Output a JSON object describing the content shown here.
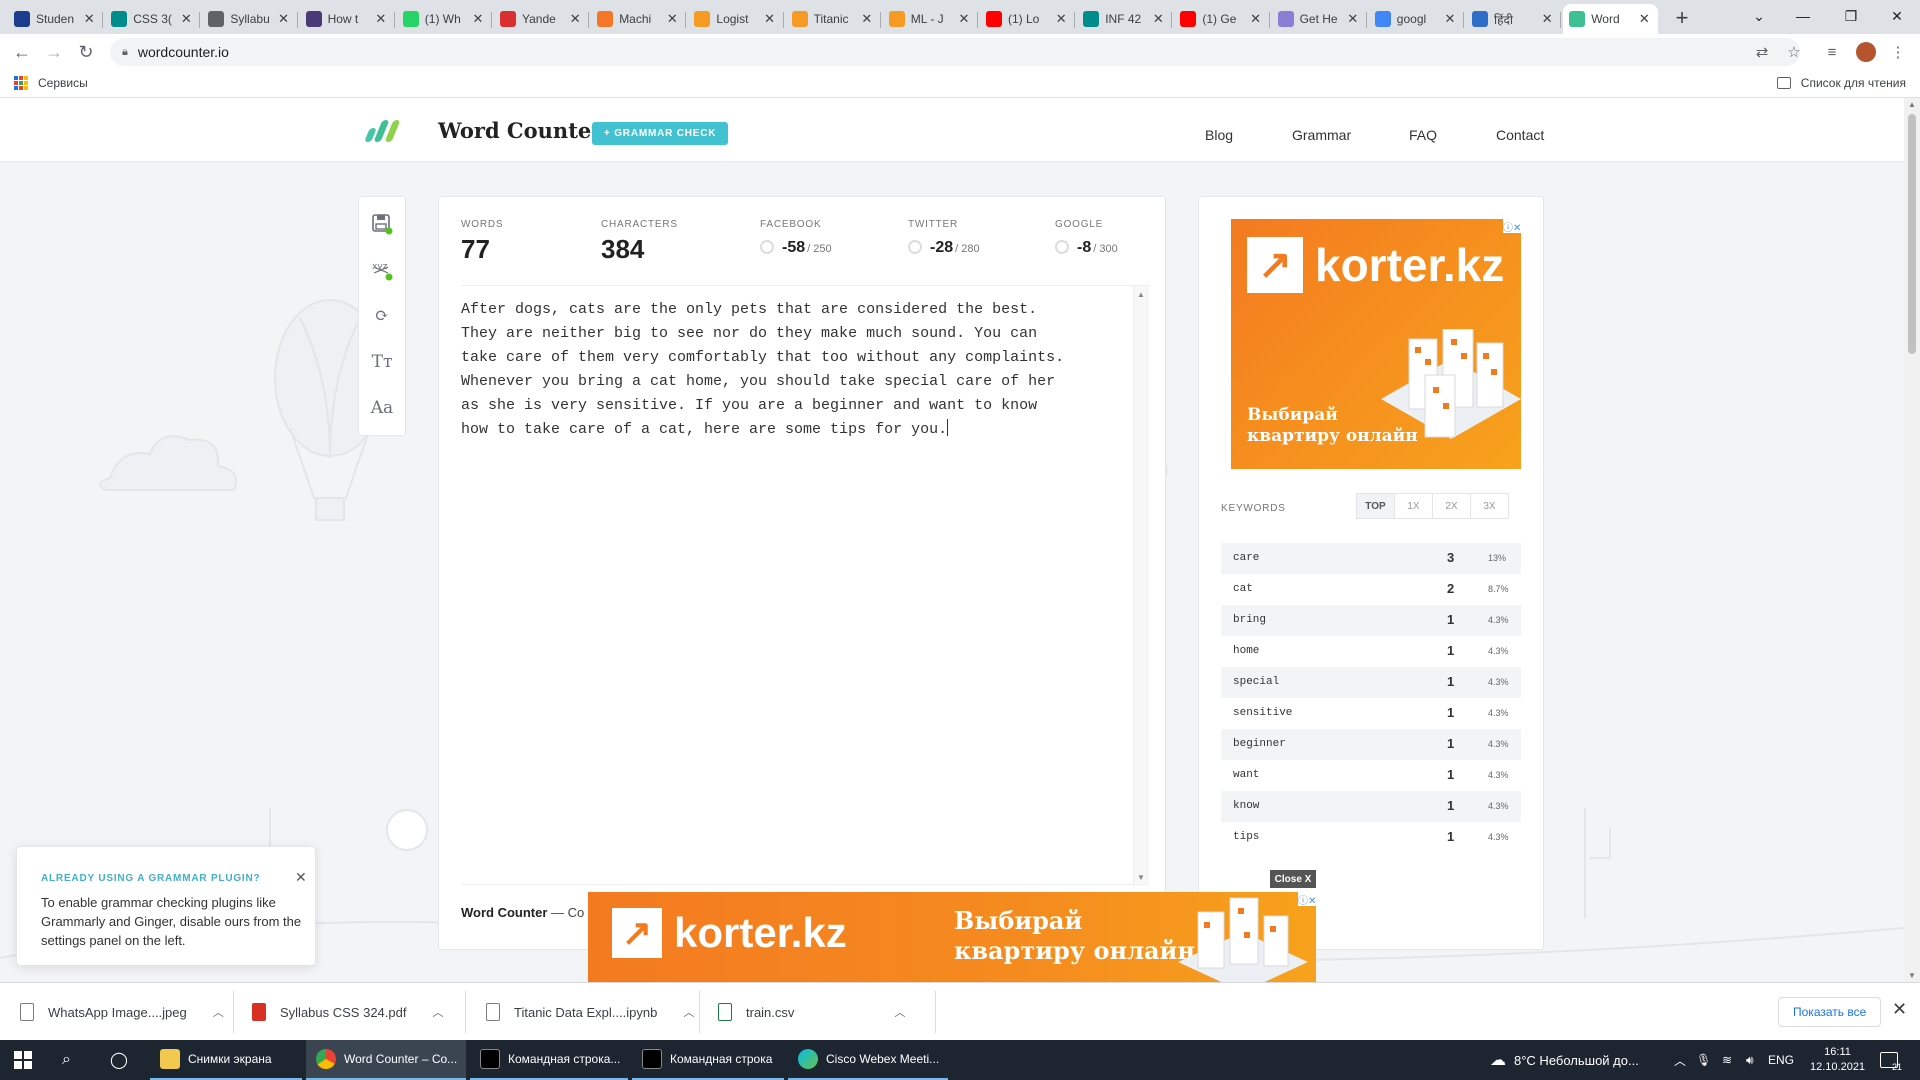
{
  "browser": {
    "tabs": [
      {
        "title": "Studen",
        "icon": "stackoverflow-icon",
        "color": "#1d3c8e"
      },
      {
        "title": "CSS 3(",
        "icon": "colab-icon",
        "color": "#008c8c"
      },
      {
        "title": "Syllabu",
        "icon": "globe-icon",
        "color": "#5f6368"
      },
      {
        "title": "How t",
        "icon": "medium-icon",
        "color": "#4b3a78"
      },
      {
        "title": "(1) Wh",
        "icon": "whatsapp-icon",
        "color": "#25d366"
      },
      {
        "title": "Yande",
        "icon": "yandex-icon",
        "color": "#d92f2f"
      },
      {
        "title": "Machi",
        "icon": "jupyter-icon",
        "color": "#f37726"
      },
      {
        "title": "Logist",
        "icon": "book-icon",
        "color": "#f59b23"
      },
      {
        "title": "Titanic",
        "icon": "book-icon",
        "color": "#f59b23"
      },
      {
        "title": "ML - J",
        "icon": "book-icon",
        "color": "#f59b23"
      },
      {
        "title": "(1) Lo",
        "icon": "youtube-icon",
        "color": "#ff0000"
      },
      {
        "title": "INF 42",
        "icon": "colab-icon",
        "color": "#008c8c"
      },
      {
        "title": "(1) Ge",
        "icon": "youtube-icon",
        "color": "#ff0000"
      },
      {
        "title": "Get He",
        "icon": "ecology-icon",
        "color": "#8a7fd6"
      },
      {
        "title": "googl",
        "icon": "google-icon",
        "color": "#4285f4"
      },
      {
        "title": "हिंदी",
        "icon": "translate-icon",
        "color": "#2f6dc9"
      },
      {
        "title": "Word",
        "icon": "wordcounter-icon",
        "color": "#3ebf94"
      }
    ],
    "new_tab": "+",
    "url": "wordcounter.io",
    "bookmarks_apps": "Сервисы",
    "reading_list": "Список для чтения"
  },
  "site": {
    "title": "Word Counter",
    "grammar_button": "+ GRAMMAR CHECK",
    "nav": [
      "Blog",
      "Grammar",
      "FAQ",
      "Contact"
    ]
  },
  "stats": {
    "words_label": "WORDS",
    "words": "77",
    "characters_label": "CHARACTERS",
    "characters": "384",
    "facebook_label": "FACEBOOK",
    "facebook_value": "-58",
    "facebook_max": "/ 250",
    "twitter_label": "TWITTER",
    "twitter_value": "-28",
    "twitter_max": "/ 280",
    "google_label": "GOOGLE",
    "google_value": "-8",
    "google_max": "/ 300"
  },
  "editor": {
    "text": "After dogs, cats are the only pets that are considered the best.\nThey are neither big to see nor do they make much sound. You can\ntake care of them very comfortably that too without any complaints.\nWhenever you bring a cat home, you should take special care of her\nas she is very sensitive. If you are a beginner and want to know\nhow to take care of a cat, here are some tips for you.",
    "footer_brand": "Word Counter",
    "footer_rest": "— Co"
  },
  "ads": {
    "brand": "korter.kz",
    "slogan_line1": "Выбирай",
    "slogan_line2": "квартиру онлайн",
    "close_label": "Close X"
  },
  "keywords": {
    "label": "KEYWORDS",
    "tabs": [
      "TOP",
      "1X",
      "2X",
      "3X"
    ],
    "rows": [
      {
        "word": "care",
        "count": "3",
        "pct": "13%"
      },
      {
        "word": "cat",
        "count": "2",
        "pct": "8.7%"
      },
      {
        "word": "bring",
        "count": "1",
        "pct": "4.3%"
      },
      {
        "word": "home",
        "count": "1",
        "pct": "4.3%"
      },
      {
        "word": "special",
        "count": "1",
        "pct": "4.3%"
      },
      {
        "word": "sensitive",
        "count": "1",
        "pct": "4.3%"
      },
      {
        "word": "beginner",
        "count": "1",
        "pct": "4.3%"
      },
      {
        "word": "want",
        "count": "1",
        "pct": "4.3%"
      },
      {
        "word": "know",
        "count": "1",
        "pct": "4.3%"
      },
      {
        "word": "tips",
        "count": "1",
        "pct": "4.3%"
      }
    ]
  },
  "popup": {
    "title": "ALREADY USING A GRAMMAR PLUGIN?",
    "body": "To enable grammar checking plugins like Grammarly and Ginger, disable ours from the settings panel on the left."
  },
  "downloads": {
    "items": [
      "WhatsApp Image....jpeg",
      "Syllabus CSS 324.pdf",
      "Titanic Data Expl....ipynb",
      "train.csv"
    ],
    "show_all": "Показать все"
  },
  "taskbar": {
    "apps": [
      "Снимки экрана",
      "Word Counter – Co...",
      "Командная строка...",
      "Командная строка",
      "Cisco Webex Meeti..."
    ],
    "weather": "8°C  Небольшой до...",
    "lang": "ENG",
    "time": "16:11",
    "date": "12.10.2021",
    "notifications": "21"
  }
}
